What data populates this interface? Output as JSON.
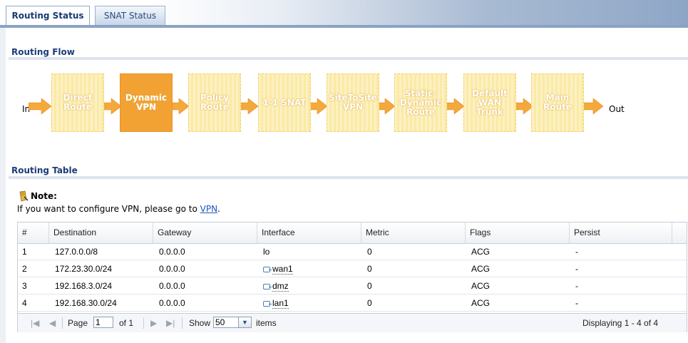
{
  "tabs": {
    "active": "Routing Status",
    "inactive": "SNAT Status"
  },
  "flow_section": {
    "title": "Routing Flow",
    "in_label": "In",
    "out_label": "Out",
    "steps": [
      {
        "label": "Direct\nRoute",
        "active": false
      },
      {
        "label": "Dynamic\nVPN",
        "active": true
      },
      {
        "label": "Policy\nRoute",
        "active": false
      },
      {
        "label": "1-1 SNAT",
        "active": false
      },
      {
        "label": "SiteToSite\nVPN",
        "active": false
      },
      {
        "label": "Static-\nDynamic\nRoute",
        "active": false
      },
      {
        "label": "Default\nWAN\nTrunk",
        "active": false
      },
      {
        "label": "Main\nRoute",
        "active": false
      }
    ]
  },
  "table_section": {
    "title": "Routing Table",
    "note_title": "Note:",
    "note_text": "If you want to configure VPN, please go to ",
    "note_link": "VPN",
    "note_end": ".",
    "columns": [
      "#",
      "Destination",
      "Gateway",
      "Interface",
      "Metric",
      "Flags",
      "Persist"
    ],
    "rows": [
      {
        "num": "1",
        "destination": "127.0.0.0/8",
        "gateway": "0.0.0.0",
        "interface": "lo",
        "iface_icon": false,
        "metric": "0",
        "flags": "ACG",
        "persist": "-"
      },
      {
        "num": "2",
        "destination": "172.23.30.0/24",
        "gateway": "0.0.0.0",
        "interface": "wan1",
        "iface_icon": true,
        "metric": "0",
        "flags": "ACG",
        "persist": "-"
      },
      {
        "num": "3",
        "destination": "192.168.3.0/24",
        "gateway": "0.0.0.0",
        "interface": "dmz",
        "iface_icon": true,
        "metric": "0",
        "flags": "ACG",
        "persist": "-"
      },
      {
        "num": "4",
        "destination": "192.168.30.0/24",
        "gateway": "0.0.0.0",
        "interface": "lan1",
        "iface_icon": true,
        "metric": "0",
        "flags": "ACG",
        "persist": "-"
      }
    ],
    "pager": {
      "page_label": "Page",
      "page_value": "1",
      "of_label": "of 1",
      "show_label": "Show",
      "show_value": "50",
      "items_label": "items",
      "displaying": "Displaying 1 - 4 of 4"
    }
  },
  "colors": {
    "box": "#fbeaa4",
    "box_active": "#f1a233",
    "arrow": "#f3a93b",
    "heading": "#1c3d78"
  }
}
